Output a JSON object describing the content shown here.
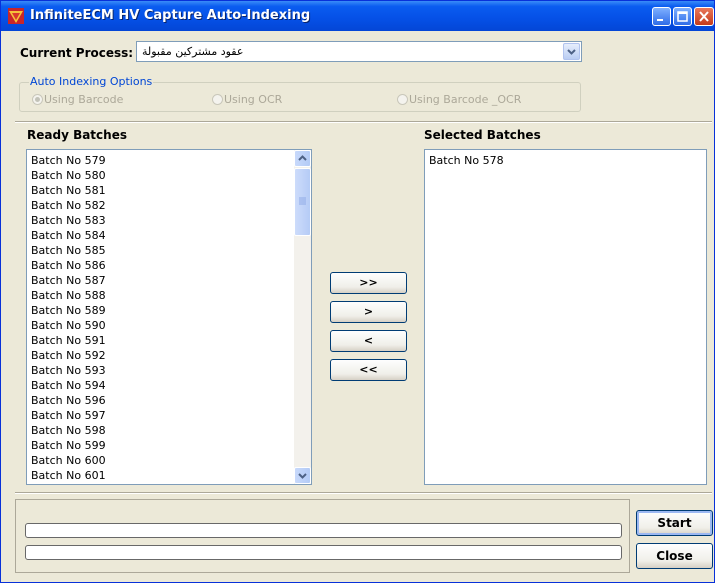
{
  "window": {
    "title": "InfiniteECM HV Capture Auto-Indexing"
  },
  "process": {
    "label": "Current Process:",
    "value": "عقود مشتركين مقبولة"
  },
  "auto_indexing": {
    "legend": "Auto Indexing Options",
    "options": [
      {
        "label": "Using Barcode",
        "checked": true
      },
      {
        "label": "Using OCR",
        "checked": false
      },
      {
        "label": "Using Barcode _OCR",
        "checked": false
      }
    ]
  },
  "ready_batches": {
    "label": "Ready Batches",
    "items": [
      "Batch No 579",
      "Batch No 580",
      "Batch No 581",
      "Batch No 582",
      "Batch No 583",
      "Batch No 584",
      "Batch No 585",
      "Batch No 586",
      "Batch No 587",
      "Batch No 588",
      "Batch No 589",
      "Batch No 590",
      "Batch No 591",
      "Batch No 592",
      "Batch No 593",
      "Batch No 594",
      "Batch No 596",
      "Batch No 597",
      "Batch No 598",
      "Batch No 599",
      "Batch No 600",
      "Batch No 601"
    ]
  },
  "selected_batches": {
    "label": "Selected Batches",
    "items": [
      "Batch No 578"
    ]
  },
  "transfer_buttons": {
    "add_all": ">>",
    "add": ">",
    "remove": "<",
    "remove_all": "<<"
  },
  "progress": {
    "bar1": 0,
    "bar2": 0
  },
  "actions": {
    "start": "Start",
    "close": "Close"
  }
}
